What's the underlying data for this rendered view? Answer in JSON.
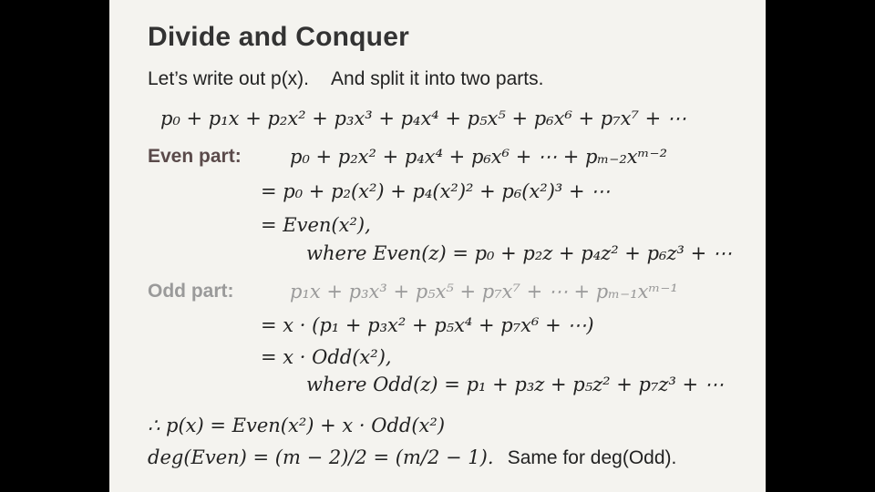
{
  "slide": {
    "title": "Divide and Conquer",
    "intro_left": "Let’s write out p(x).",
    "intro_right": "And split it into two parts.",
    "poly_line": "p₀ + p₁x + p₂x² + p₃x³ + p₄x⁴ + p₅x⁵ + p₆x⁶ + p₇x⁷ + ⋯",
    "even": {
      "label": "Even part:",
      "line1": "p₀ + p₂x² + p₄x⁴ + p₆x⁶ + ⋯ + pₘ₋₂xᵐ⁻²",
      "line2": "= p₀ + p₂(x²) + p₄(x²)² + p₆(x²)³ + ⋯",
      "line3": "= Even(x²),",
      "line4": "where Even(z) = p₀ + p₂z + p₄z² + p₆z³ + ⋯"
    },
    "odd": {
      "label": "Odd part:",
      "line1": "p₁x + p₃x³ + p₅x⁵ + p₇x⁷ + ⋯ + pₘ₋₁xᵐ⁻¹",
      "line2": "= x · (p₁ + p₃x² + p₅x⁴ + p₇x⁶ + ⋯)",
      "line3": "= x · Odd(x²),",
      "line4": "where Odd(z) = p₁ + p₃z + p₅z² + p₇z³ + ⋯"
    },
    "conclusion": "∴ p(x) = Even(x²) + x · Odd(x²)",
    "degree_math": "deg(Even) = (m − 2)/2 = (m/2 − 1).",
    "degree_text": "Same for deg(Odd)."
  }
}
